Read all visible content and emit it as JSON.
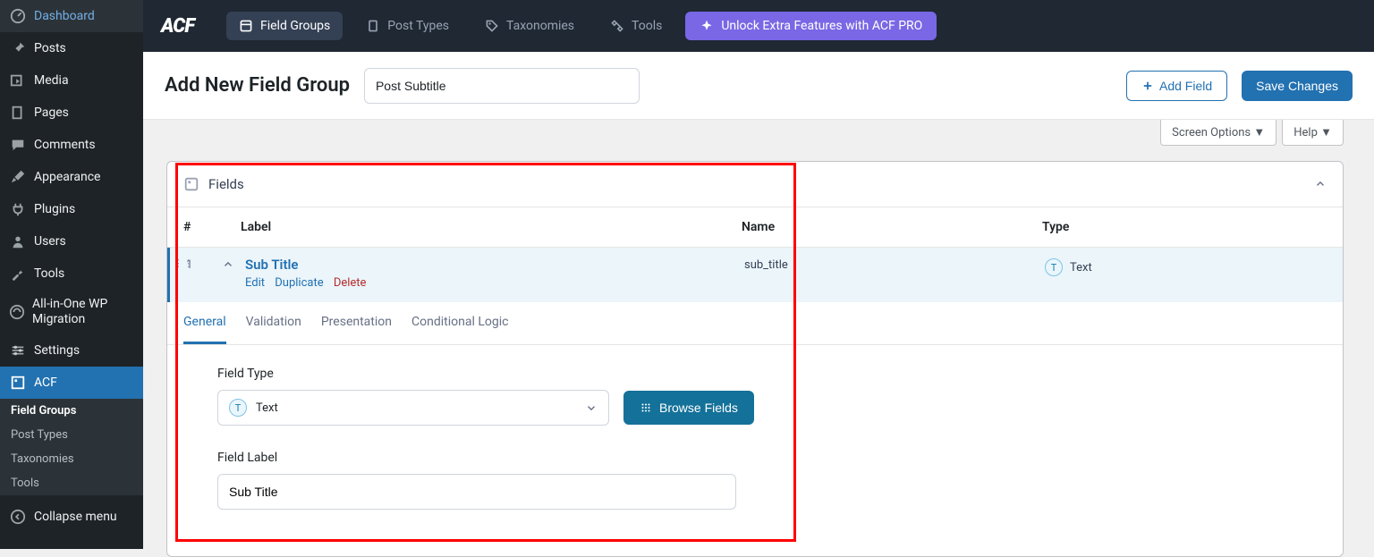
{
  "sidebar": {
    "items": [
      {
        "label": "Dashboard"
      },
      {
        "label": "Posts"
      },
      {
        "label": "Media"
      },
      {
        "label": "Pages"
      },
      {
        "label": "Comments"
      },
      {
        "label": "Appearance"
      },
      {
        "label": "Plugins"
      },
      {
        "label": "Users"
      },
      {
        "label": "Tools"
      },
      {
        "label": "All-in-One WP Migration"
      },
      {
        "label": "Settings"
      },
      {
        "label": "ACF"
      }
    ],
    "sub": [
      {
        "label": "Field Groups"
      },
      {
        "label": "Post Types"
      },
      {
        "label": "Taxonomies"
      },
      {
        "label": "Tools"
      }
    ],
    "collapse": "Collapse menu"
  },
  "topbar": {
    "logo": "ACF",
    "tabs": [
      {
        "label": "Field Groups"
      },
      {
        "label": "Post Types"
      },
      {
        "label": "Taxonomies"
      },
      {
        "label": "Tools"
      }
    ],
    "upsell": "Unlock Extra Features with ACF PRO"
  },
  "header": {
    "title": "Add New Field Group",
    "group_name": "Post Subtitle",
    "add_field": "Add Field",
    "save": "Save Changes"
  },
  "screen_opts": {
    "screen": "Screen Options",
    "help": "Help"
  },
  "panel": {
    "title": "Fields",
    "cols": {
      "num": "#",
      "label": "Label",
      "name": "Name",
      "type": "Type"
    },
    "row": {
      "num": "1",
      "label": "Sub Title",
      "name": "sub_title",
      "type": "Text",
      "actions": {
        "edit": "Edit",
        "dup": "Duplicate",
        "del": "Delete"
      }
    },
    "subtabs": [
      "General",
      "Validation",
      "Presentation",
      "Conditional Logic"
    ],
    "settings": {
      "field_type_label": "Field Type",
      "field_type_value": "Text",
      "browse": "Browse Fields",
      "field_label_label": "Field Label",
      "field_label_value": "Sub Title"
    }
  }
}
